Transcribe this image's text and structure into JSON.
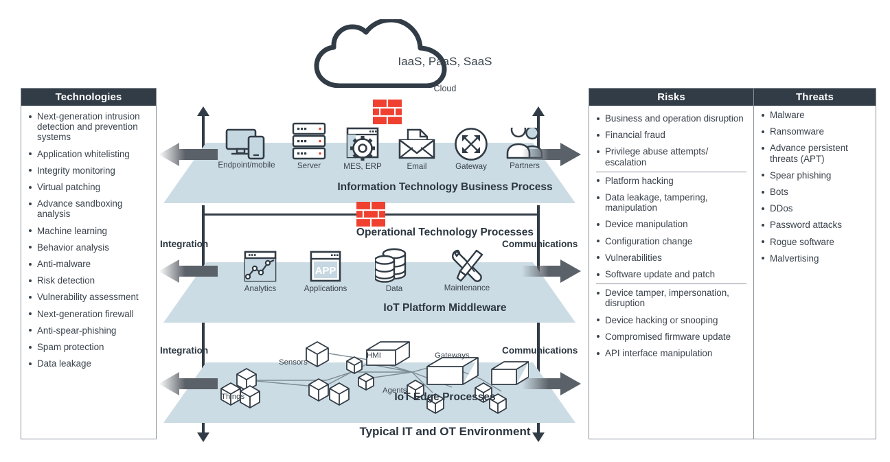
{
  "diagram": {
    "bottom_title": "Typical IT and OT Environment"
  },
  "cloud": {
    "text": "IaaS, PaaS, SaaS",
    "label": "Cloud",
    "icon": "cloud-icon"
  },
  "firewalls": [
    {
      "name": "firewall-brick-top",
      "color": "#ef4030"
    },
    {
      "name": "firewall-brick-middle",
      "color": "#ef4030"
    }
  ],
  "layers": [
    {
      "id": "it",
      "title": "Information Technology Business Process",
      "icons": [
        {
          "label": "Endpoint/mobile",
          "icon": "monitor-mobile-icon"
        },
        {
          "label": "Server",
          "icon": "server-rack-icon"
        },
        {
          "label": "MES, ERP",
          "icon": "window-gear-icon"
        },
        {
          "label": "Email",
          "icon": "envelope-icon"
        },
        {
          "label": "Gateway",
          "icon": "gateway-arrows-circle-icon"
        },
        {
          "label": "Partners",
          "icon": "people-icon"
        }
      ]
    },
    {
      "id": "ot",
      "title": "Operational Technology Processes"
    },
    {
      "id": "middleware",
      "title": "IoT Platform Middleware",
      "icons": [
        {
          "label": "Analytics",
          "icon": "line-chart-icon"
        },
        {
          "label": "Applications",
          "icon": "app-window-icon"
        },
        {
          "label": "Data",
          "icon": "database-cylinders-icon"
        },
        {
          "label": "Maintenance",
          "icon": "wrench-screwdriver-icon"
        }
      ]
    },
    {
      "id": "edge",
      "title": "IoT Edge Processes",
      "node_labels": [
        {
          "label": "Sensors",
          "icon": "cube-node-icon"
        },
        {
          "label": "HMI",
          "icon": "cube-node-icon"
        },
        {
          "label": "Gateways",
          "icon": "cube-node-icon"
        },
        {
          "label": "Agents",
          "icon": "cube-node-icon"
        },
        {
          "label": "Things",
          "icon": "cube-node-icon"
        }
      ]
    }
  ],
  "side_labels": {
    "integration_middleware": "Integration",
    "integration_edge": "Integration",
    "communications_middleware": "Communications",
    "communications_edge": "Communications"
  },
  "technologies": {
    "title": "Technologies",
    "items": [
      "Next-generation intrusion detection and prevention systems",
      "Application whitelisting",
      "Integrity monitoring",
      "Virtual patching",
      "Advance sandboxing analysis",
      "Machine learning",
      "Behavior analysis",
      "Anti-malware",
      "Risk detection",
      "Vulnerability assessment",
      "Next-generation firewall",
      "Anti-spear-phishing",
      "Spam protection",
      "Data leakage"
    ]
  },
  "risks": {
    "title": "Risks",
    "groups": [
      {
        "items": [
          "Business and operation disruption",
          "Financial fraud",
          "Privilege abuse attempts/ escalation"
        ]
      },
      {
        "items": [
          "Platform hacking",
          "Data leakage, tampering, manipulation",
          "Device manipulation",
          "Configuration change",
          "Vulnerabilities",
          "Software update and patch"
        ]
      },
      {
        "items": [
          "Device tamper, impersonation, disruption",
          "Device hacking or snooping",
          "Compromised firmware update",
          "API interface manipulation"
        ]
      }
    ]
  },
  "threats": {
    "title": "Threats",
    "items": [
      "Malware",
      "Ransomware",
      "Advance persistent threats (APT)",
      "Spear phishing",
      "Bots",
      "DDos",
      "Password attacks",
      "Rogue software",
      "Malvertising"
    ]
  },
  "colors": {
    "header_bg": "#323c46",
    "slab": "#ccdce4",
    "firewall_red": "#ef4030",
    "rail": "#323c46",
    "arrow_gray": "#5b6168",
    "icon_fill": "#c5d7e0"
  }
}
